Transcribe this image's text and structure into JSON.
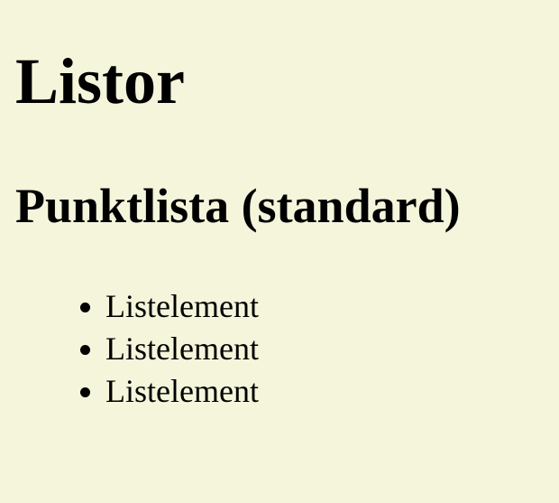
{
  "document": {
    "title": "Listor",
    "section_heading": "Punktlista (standard)",
    "list_items": [
      "Listelement",
      "Listelement",
      "Listelement"
    ]
  },
  "colors": {
    "background": "#f5f5dc",
    "text": "#000000"
  }
}
